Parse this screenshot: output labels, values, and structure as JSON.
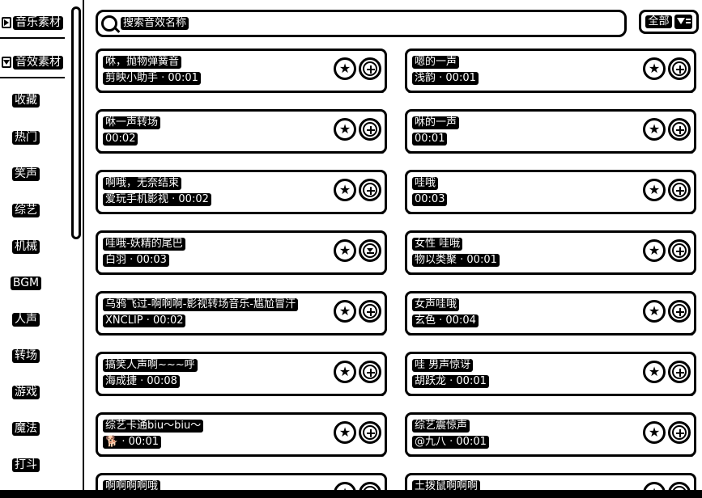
{
  "sidebar": {
    "sections": [
      {
        "label": "音乐素材",
        "expanded": false
      },
      {
        "label": "音效素材",
        "expanded": true
      }
    ],
    "items": [
      "收藏",
      "热门",
      "笑声",
      "综艺",
      "机械",
      "BGM",
      "人声",
      "转场",
      "游戏",
      "魔法",
      "打斗"
    ]
  },
  "search": {
    "placeholder": "搜索音效名称"
  },
  "filter": {
    "label": "全部",
    "icon": "filter-icon"
  },
  "cards": [
    {
      "title": "咻，抛物弹簧音",
      "author": "剪映小助手",
      "duration": "00:01",
      "action": "add"
    },
    {
      "title": "嗯的一声",
      "author": "浅韵",
      "duration": "00:01",
      "action": "add"
    },
    {
      "title": "咻一声转场",
      "author": "",
      "duration": "00:02",
      "action": "add"
    },
    {
      "title": "咻的一声",
      "author": "",
      "duration": "00:01",
      "action": "add"
    },
    {
      "title": "啊哦，无奈结束",
      "author": "爱玩手机影视",
      "duration": "00:02",
      "action": "add"
    },
    {
      "title": "哇哦",
      "author": "",
      "duration": "00:03",
      "action": "add"
    },
    {
      "title": "哇哦-妖精的尾巴",
      "author": "白羽",
      "duration": "00:03",
      "action": "download"
    },
    {
      "title": "女性 哇哦",
      "author": "物以类聚",
      "duration": "00:01",
      "action": "add"
    },
    {
      "title": "乌鸦飞过-啊啊啊-影视转场音乐-尴尬冒汗",
      "author": "XNCLIP",
      "duration": "00:02",
      "action": "add"
    },
    {
      "title": "女声哇哦",
      "author": "玄色",
      "duration": "00:04",
      "action": "add"
    },
    {
      "title": "搞笑人声啊~~~呼",
      "author": "海成捷",
      "duration": "00:08",
      "action": "add"
    },
    {
      "title": "哇 男声惊讶",
      "author": "胡跃龙",
      "duration": "00:01",
      "action": "add"
    },
    {
      "title": "综艺卡通biu～biu～",
      "author": "🐕",
      "duration": "00:01",
      "action": "add"
    },
    {
      "title": "综艺震惊声",
      "author": "@九八",
      "duration": "00:01",
      "action": "add"
    },
    {
      "title": "啊啊啊啊哦",
      "author": "",
      "duration": "",
      "action": "add"
    },
    {
      "title": "土拨鼠啊啊啊",
      "author": "",
      "duration": "",
      "action": "add"
    }
  ],
  "icons": {
    "favorite": "star-icon",
    "add": "plus-circle-icon",
    "download": "download-icon"
  }
}
